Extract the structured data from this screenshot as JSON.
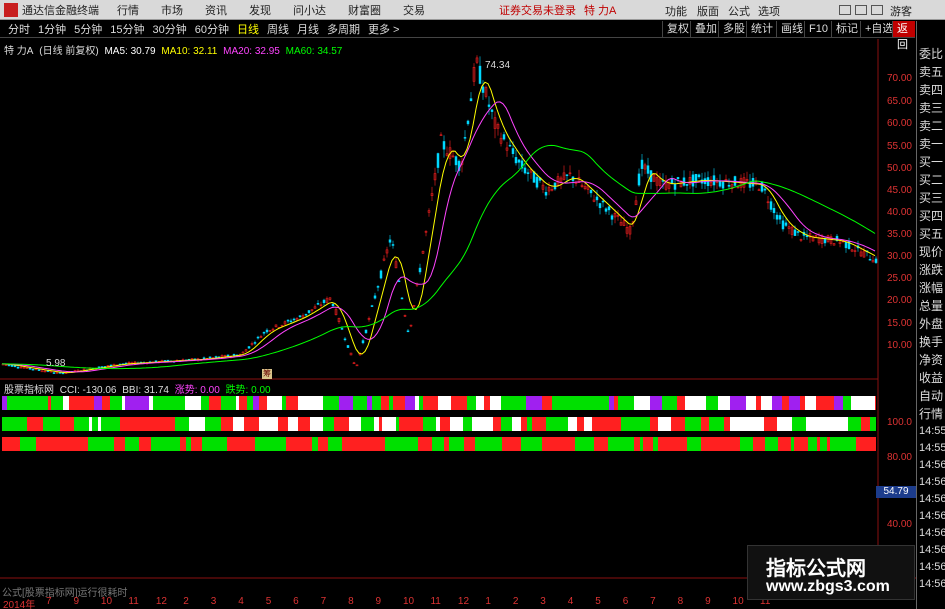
{
  "app": {
    "title": "通达信金融终端",
    "logo_text": "L",
    "menus": [
      "行情",
      "市场",
      "资讯",
      "发现",
      "问小达",
      "财富圈",
      "交易"
    ],
    "login_status": "证券交易未登录",
    "stock_name": "特 力A",
    "right_tools": [
      "功能",
      "版面",
      "公式",
      "选项",
      "游客"
    ]
  },
  "toolbar": {
    "periods": [
      "分时",
      "1分钟",
      "5分钟",
      "15分钟",
      "30分钟",
      "60分钟",
      "日线",
      "周线",
      "月线",
      "多周期",
      "更多 >"
    ],
    "active_period": "日线",
    "tools": [
      "复权",
      "叠加",
      "多股",
      "统计",
      "画线",
      "F10",
      "标记",
      "+自选",
      "返回"
    ]
  },
  "chart_header": {
    "stock": "特 力A",
    "mode": "(日线 前复权)",
    "ma5": "MA5: 30.79",
    "ma10": "MA10: 32.11",
    "ma20": "MA20: 32.95",
    "ma60": "MA60: 34.57",
    "ma5_color": "#ffffff",
    "ma10_color": "#ffff00",
    "ma20_color": "#ff44ff",
    "ma60_color": "#00ff00"
  },
  "indicator_header": {
    "name": "股票指标网",
    "cci": "CCI: -130.06",
    "bbi": "BBI: 31.74",
    "up": "涨势: 0.00",
    "down": "跌势: 0.00",
    "up_color": "#ff44ff",
    "down_color": "#00ff00"
  },
  "price_axis": [
    "70.00",
    "65.00",
    "60.00",
    "55.00",
    "50.00",
    "45.00",
    "40.00",
    "35.00",
    "30.00",
    "25.00",
    "20.00",
    "15.00",
    "10.00"
  ],
  "indicator_axis": [
    "100.0",
    "80.00",
    "40.00"
  ],
  "value_badge": "54.79",
  "peak_label": "74.34",
  "low_label": "5.98",
  "marker_text": "筹",
  "side_panel": {
    "items": [
      "委比",
      "卖五",
      "卖四",
      "卖三",
      "卖二",
      "卖一",
      "买一",
      "买二",
      "买三",
      "买四",
      "买五",
      "现价",
      "涨跌",
      "涨幅",
      "总量",
      "外盘",
      "换手",
      "净资",
      "收益",
      "自动",
      "行情"
    ],
    "times": [
      "14:55",
      "14:55",
      "14:56",
      "14:56",
      "14:56",
      "14:56",
      "14:56",
      "14:56",
      "14:56",
      "14:56"
    ]
  },
  "date_axis": {
    "first": "2014年",
    "ticks": [
      "7",
      "9",
      "10",
      "11",
      "12",
      "2",
      "3",
      "4",
      "5",
      "6",
      "7",
      "8",
      "9",
      "10",
      "11",
      "12",
      "1",
      "2",
      "3",
      "4",
      "5",
      "6",
      "7",
      "8",
      "9",
      "10",
      "11"
    ]
  },
  "formula_bar": "公式[股票指标网]运行很耗时",
  "watermark": {
    "title": "指标公式网",
    "url": "www.zbgs3.com"
  },
  "colors": {
    "up": "#ff2020",
    "down": "#00e000",
    "accent": "#c00000"
  }
}
